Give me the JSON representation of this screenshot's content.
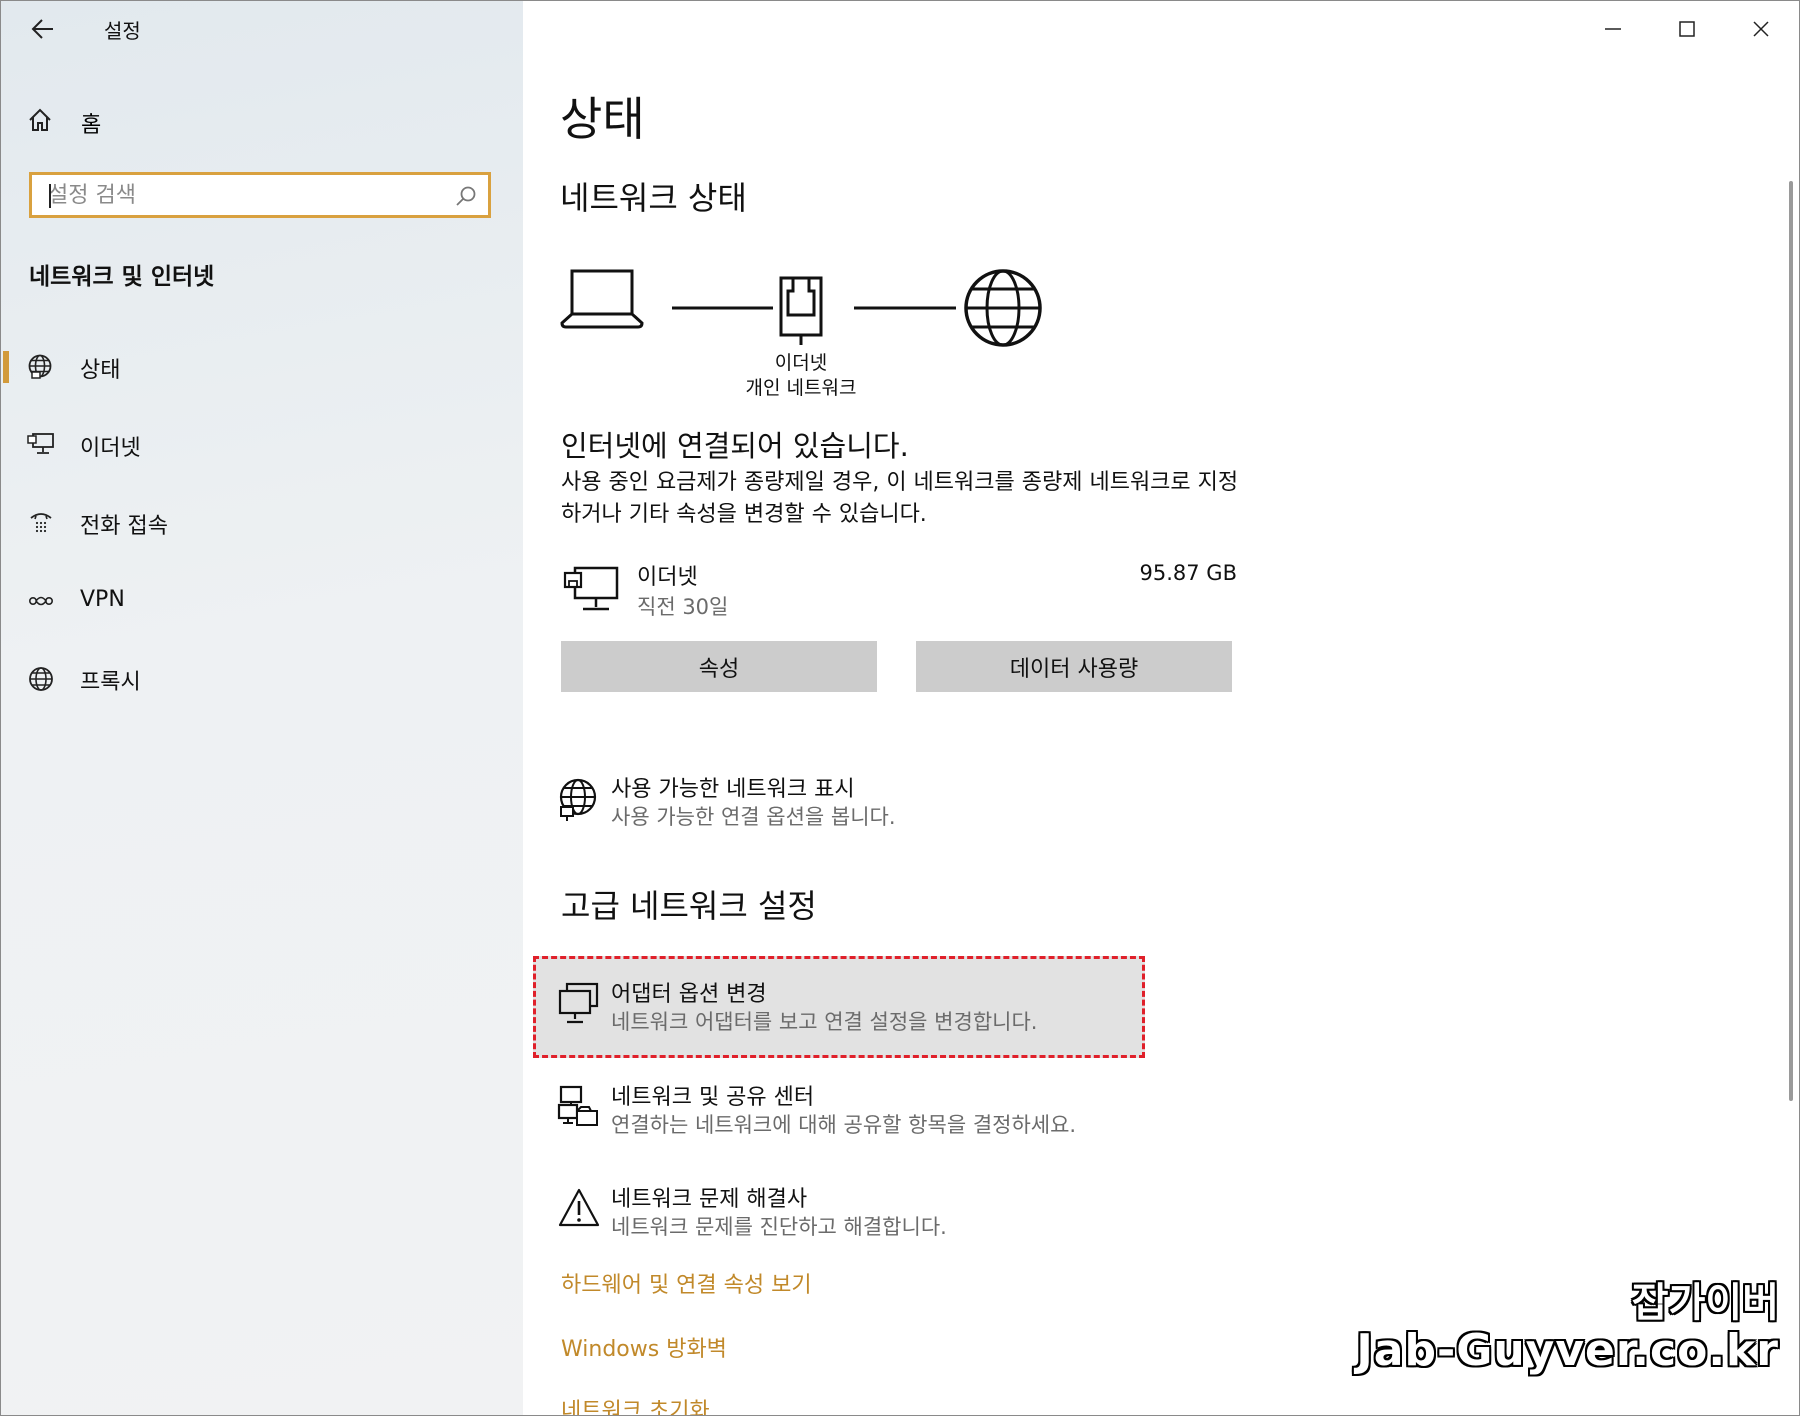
{
  "window": {
    "app_title": "설정",
    "controls": {
      "minimize": "minimize",
      "maximize": "maximize",
      "close": "close"
    }
  },
  "sidebar": {
    "home_label": "홈",
    "search": {
      "placeholder": "설정 검색",
      "value": ""
    },
    "section_label": "네트워크 및 인터넷",
    "items": [
      {
        "label": "상태",
        "icon": "globe-status-icon",
        "active": true
      },
      {
        "label": "이더넷",
        "icon": "ethernet-icon",
        "active": false
      },
      {
        "label": "전화 접속",
        "icon": "dialup-icon",
        "active": false
      },
      {
        "label": "VPN",
        "icon": "vpn-icon",
        "active": false
      },
      {
        "label": "프록시",
        "icon": "globe-icon",
        "active": false
      }
    ]
  },
  "main": {
    "page_title": "상태",
    "network_status_heading": "네트워크 상태",
    "diagram": {
      "device_icon": "laptop-icon",
      "adapter_icon": "ethernet-port-icon",
      "internet_icon": "globe-icon",
      "caption_line1": "이더넷",
      "caption_line2": "개인 네트워크"
    },
    "connection_title": "인터넷에 연결되어 있습니다.",
    "connection_desc": "사용 중인 요금제가 종량제일 경우, 이 네트워크를 종량제 네트워크로 지정하거나 기타 속성을 변경할 수 있습니다.",
    "adapter": {
      "name": "이더넷",
      "period": "직전 30일",
      "usage": "95.87 GB"
    },
    "buttons": {
      "properties": "속성",
      "data_usage": "데이터 사용량"
    },
    "show_networks": {
      "title": "사용 가능한 네트워크 표시",
      "subtitle": "사용 가능한 연결 옵션을 봅니다."
    },
    "advanced_heading": "고급 네트워크 설정",
    "advanced_items": [
      {
        "title": "어댑터 옵션 변경",
        "subtitle": "네트워크 어댑터를 보고 연결 설정을 변경합니다.",
        "icon": "adapter-monitor-icon",
        "highlighted": true
      },
      {
        "title": "네트워크 및 공유 센터",
        "subtitle": "연결하는 네트워크에 대해 공유할 항목을 결정하세요.",
        "icon": "sharing-center-icon",
        "highlighted": false
      },
      {
        "title": "네트워크 문제 해결사",
        "subtitle": "네트워크 문제를 진단하고 해결합니다.",
        "icon": "warning-icon",
        "highlighted": false
      }
    ],
    "links": [
      "하드웨어 및 연결 속성 보기",
      "Windows 방화벽",
      "네트워크 초기화"
    ]
  },
  "watermark": {
    "line1": "잡가이버",
    "line2": "Jab-Guyver.co.kr"
  },
  "colors": {
    "accent": "#d29a3a",
    "link": "#c1892a",
    "highlight_border": "#e0202a",
    "button_bg": "#cccccc"
  }
}
